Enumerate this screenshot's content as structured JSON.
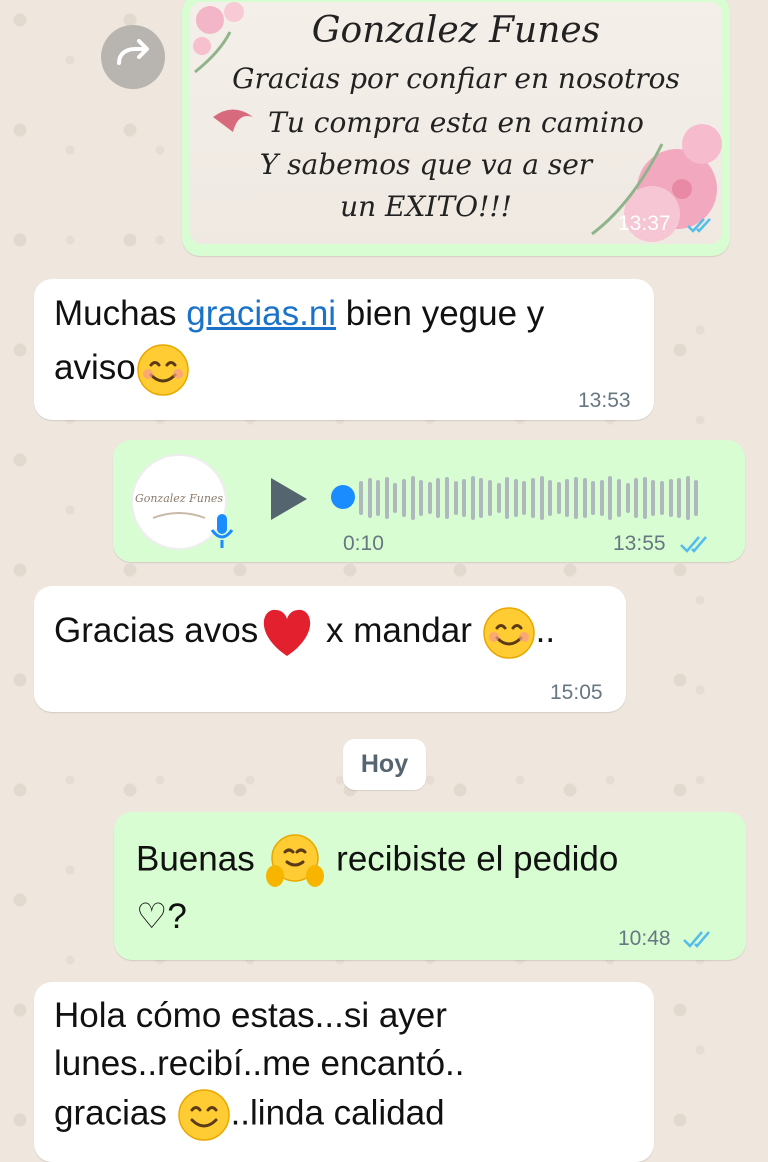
{
  "forwarded_image": {
    "brand": "Gonzalez Funes",
    "line1": "Gracias por confiar en nosotros",
    "line2": "Tu compra esta en camino",
    "line3": "Y sabemos que va a ser",
    "line4": "un EXITO!!!",
    "time": "13:37",
    "status": "read"
  },
  "messages": [
    {
      "direction": "in",
      "text_before": "Muchas ",
      "link": "gracias.ni",
      "text_after": " bien yegue y",
      "line2": "aviso",
      "emoji": "smiling-face",
      "time": "13:53"
    },
    {
      "direction": "out",
      "type": "voice",
      "duration": "0:10",
      "time": "13:55",
      "status": "read"
    },
    {
      "direction": "in",
      "text_a": "Gracias avos",
      "text_b": " x mandar ",
      "text_c": "..",
      "time": "15:05"
    },
    {
      "direction": "out",
      "line1_a": "Buenas ",
      "line1_b": " recibiste el pedido",
      "line2": "♡?",
      "time": "10:48",
      "status": "read"
    },
    {
      "direction": "in",
      "line1": "Hola cómo estas...si ayer",
      "line2": "lunes..recibí..me encantó..",
      "line3_a": "gracias ",
      "line3_b": "..linda calidad"
    }
  ],
  "date_separator": "Hoy",
  "colors": {
    "incoming": "#ffffff",
    "outgoing": "#d9fdd3",
    "read_ticks": "#53bdeb",
    "link": "#1a73c8",
    "play": "#54656f",
    "progress_dot": "#1a8cff"
  }
}
